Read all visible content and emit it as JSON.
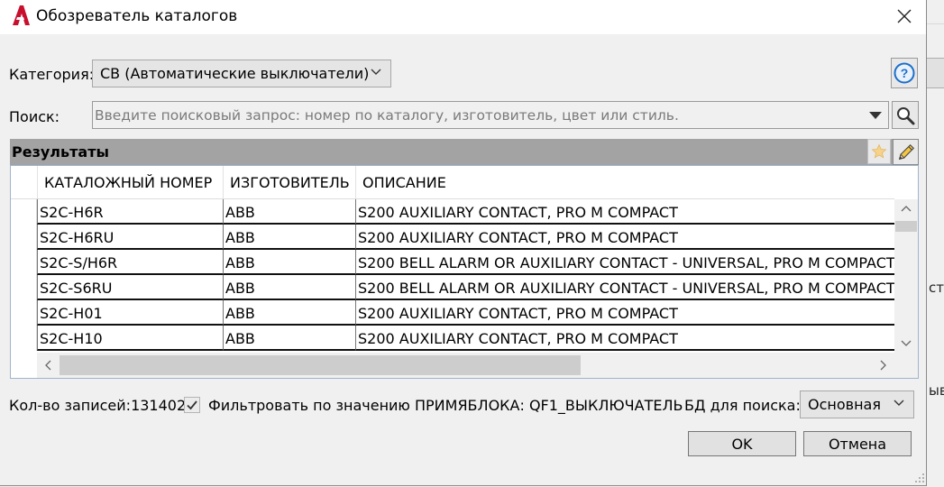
{
  "window": {
    "title": "Обозреватель каталогов"
  },
  "background_window": {
    "fragment_1": "стро",
    "fragment_2": "ыво"
  },
  "category": {
    "label": "Категория:",
    "value": "СВ (Автоматические выключатели)"
  },
  "search": {
    "label": "Поиск:",
    "placeholder": "Введите поисковый запрос: номер по каталогу, изготовитель, цвет или стиль."
  },
  "results": {
    "title": "Результаты",
    "columns": [
      "КАТАЛОЖНЫЙ НОМЕР",
      "ИЗГОТОВИТЕЛЬ",
      "ОПИСАНИЕ"
    ],
    "rows": [
      [
        "S2C-H6R",
        "ABB",
        "S200 AUXILIARY CONTACT, PRO M COMPACT"
      ],
      [
        "S2C-H6RU",
        "ABB",
        "S200 AUXILIARY CONTACT, PRO M COMPACT"
      ],
      [
        "S2C-S/H6R",
        "ABB",
        "S200 BELL ALARM OR AUXILIARY CONTACT - UNIVERSAL, PRO M COMPACT"
      ],
      [
        "S2C-S6RU",
        "ABB",
        "S200 BELL ALARM OR AUXILIARY CONTACT - UNIVERSAL, PRO M COMPACT"
      ],
      [
        "S2C-H01",
        "ABB",
        "S200 AUXILIARY CONTACT, PRO M COMPACT"
      ],
      [
        "S2C-H10",
        "ABB",
        "S200 AUXILIARY CONTACT, PRO M COMPACT"
      ]
    ]
  },
  "footer": {
    "record_count_label": "Кол-во записей:",
    "record_count": "131402",
    "filter_checked": true,
    "filter_label": "Фильтровать по значению ПРИМЯБЛОКА: QF1_ВЫКЛЮЧАТЕЛЬ",
    "db_label": "БД для поиска:",
    "db_value": "Основная",
    "ok_label": "OK",
    "cancel_label": "Отмена"
  },
  "icons": [
    "autocad-logo-icon",
    "close-icon",
    "chevron-down-icon",
    "help-icon",
    "dropdown-arrow-icon",
    "search-icon",
    "star-icon",
    "pencil-icon",
    "checkmark-icon",
    "resize-grip-icon"
  ],
  "colors": {
    "results_bar": "#a3a3a3",
    "logo": "#c8102e",
    "help": "#1c6fc9",
    "star": "#f6d28a"
  }
}
